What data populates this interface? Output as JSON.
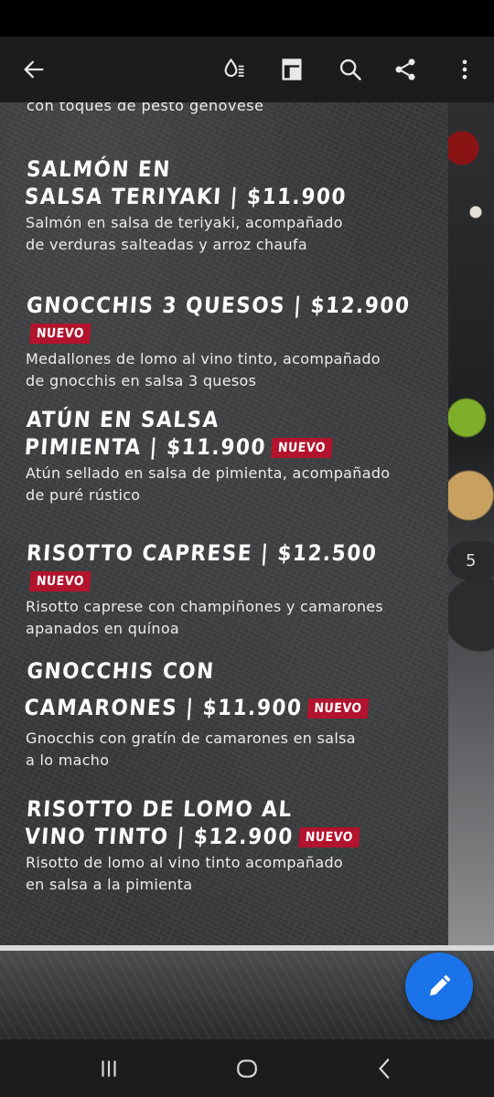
{
  "toolbar": {
    "back_icon": "arrow-left-icon",
    "reading_mode_icon": "reading-mode-icon",
    "page_layout_icon": "page-layout-icon",
    "search_icon": "search-icon",
    "share_icon": "share-icon",
    "more_icon": "more-vertical-icon"
  },
  "menu": {
    "top_snippet": "con toques de pesto genovese",
    "items": [
      {
        "title_line1": "SALMÓN EN",
        "title_line2": "SALSA TERIYAKI | $11.900",
        "badge": "",
        "desc_line1": "Salmón en salsa de teriyaki, acompañado",
        "desc_line2": "de verduras salteadas y arroz chaufa"
      },
      {
        "title_line1": "GNOCCHIS 3 QUESOS | $12.900",
        "title_line2": "",
        "badge": "NUEVO",
        "desc_line1": "Medallones de lomo al vino tinto, acompañado",
        "desc_line2": "de gnocchis en salsa 3 quesos"
      },
      {
        "title_line1": "ATÚN EN SALSA",
        "title_line2": "PIMIENTA | $11.900",
        "badge": "NUEVO",
        "desc_line1": "Atún sellado en salsa de pimienta, acompañado",
        "desc_line2": "de puré rústico"
      },
      {
        "title_line1": "RISOTTO CAPRESE | $12.500",
        "title_line2": "",
        "badge": "NUEVO",
        "desc_line1": "Risotto caprese con champiñones y camarones",
        "desc_line2": "apanados en quínoa"
      },
      {
        "title_line1": "GNOCCHIS CON",
        "title_line2": "CAMARONES | $11.900",
        "badge": "NUEVO",
        "desc_line1": "Gnocchis con gratín de camarones en salsa",
        "desc_line2": "a lo macho"
      },
      {
        "title_line1": "RISOTTO DE LOMO AL",
        "title_line2": "VINO TINTO | $12.900",
        "badge": "NUEVO",
        "desc_line1": "Risotto de lomo al vino tinto acompañado",
        "desc_line2": "en salsa a la pimienta"
      }
    ]
  },
  "page_indicator": "5",
  "fab": {
    "icon": "edit-pencil-icon",
    "color": "#1a73e8"
  },
  "badge_color": "#b2132d",
  "nav": {
    "recents_icon": "recents-icon",
    "home_icon": "home-icon",
    "back_icon": "nav-back-icon"
  }
}
